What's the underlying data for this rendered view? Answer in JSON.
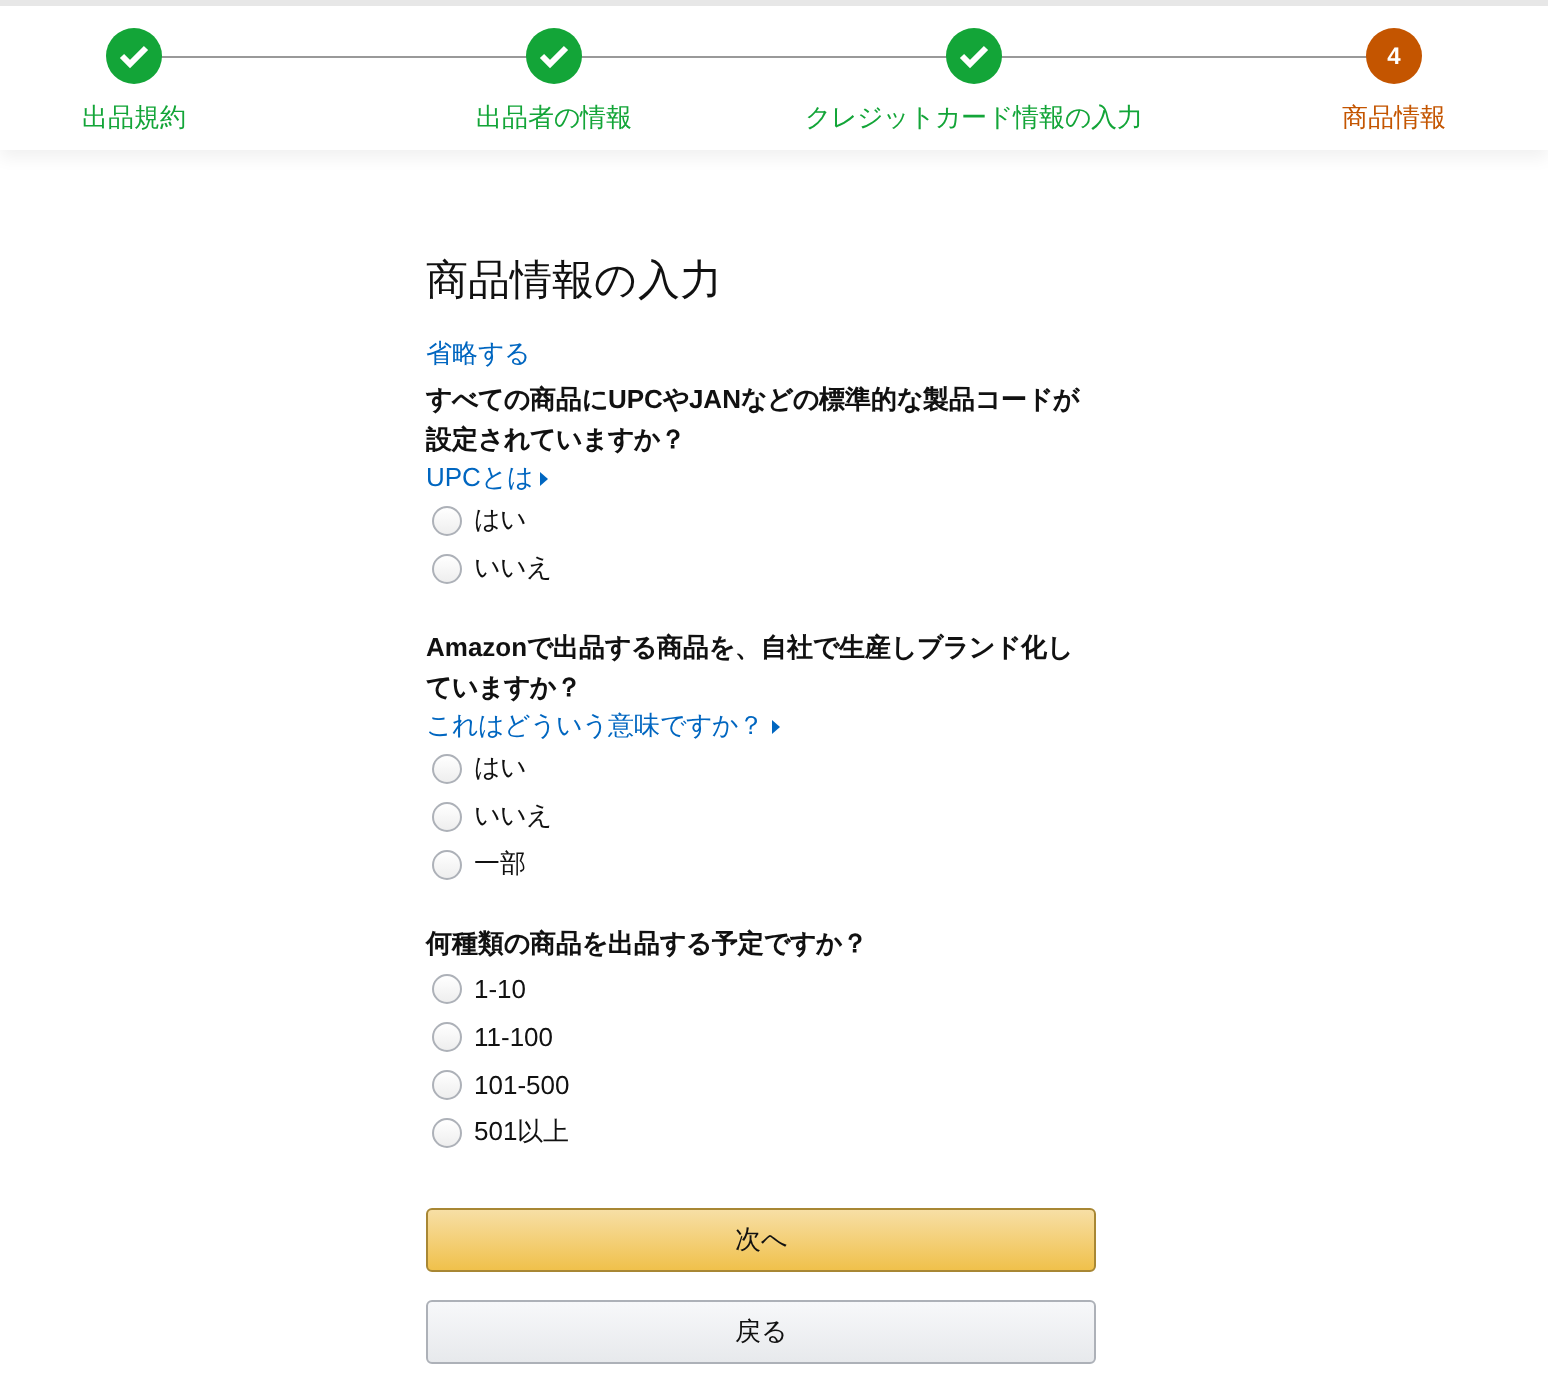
{
  "steps": [
    {
      "label": "出品規約",
      "done": true
    },
    {
      "label": "出品者の情報",
      "done": true
    },
    {
      "label": "クレジットカード情報の入力",
      "done": true
    },
    {
      "label": "商品情報",
      "done": false,
      "number": "4"
    }
  ],
  "title": "商品情報の入力",
  "skip_link": "省略する",
  "questions": [
    {
      "text": "すべての商品にUPCやJANなどの標準的な製品コードが設定されていますか？",
      "help_link": "UPCとは",
      "options": [
        {
          "label": "はい",
          "selected": false
        },
        {
          "label": "いいえ",
          "selected": false
        }
      ]
    },
    {
      "text": "Amazonで出品する商品を、自社で生産しブランド化していますか？",
      "help_link": "これはどういう意味ですか？",
      "options": [
        {
          "label": "はい",
          "selected": false
        },
        {
          "label": "いいえ",
          "selected": false
        },
        {
          "label": "一部",
          "selected": false
        }
      ]
    },
    {
      "text": "何種類の商品を出品する予定ですか？",
      "options": [
        {
          "label": "1-10",
          "selected": false
        },
        {
          "label": "11-100",
          "selected": false
        },
        {
          "label": "101-500",
          "selected": false
        },
        {
          "label": "501以上",
          "selected": false
        }
      ]
    }
  ],
  "buttons": [
    {
      "label": "次へ",
      "kind": "primary"
    },
    {
      "label": "戻る",
      "kind": "secondary"
    }
  ]
}
